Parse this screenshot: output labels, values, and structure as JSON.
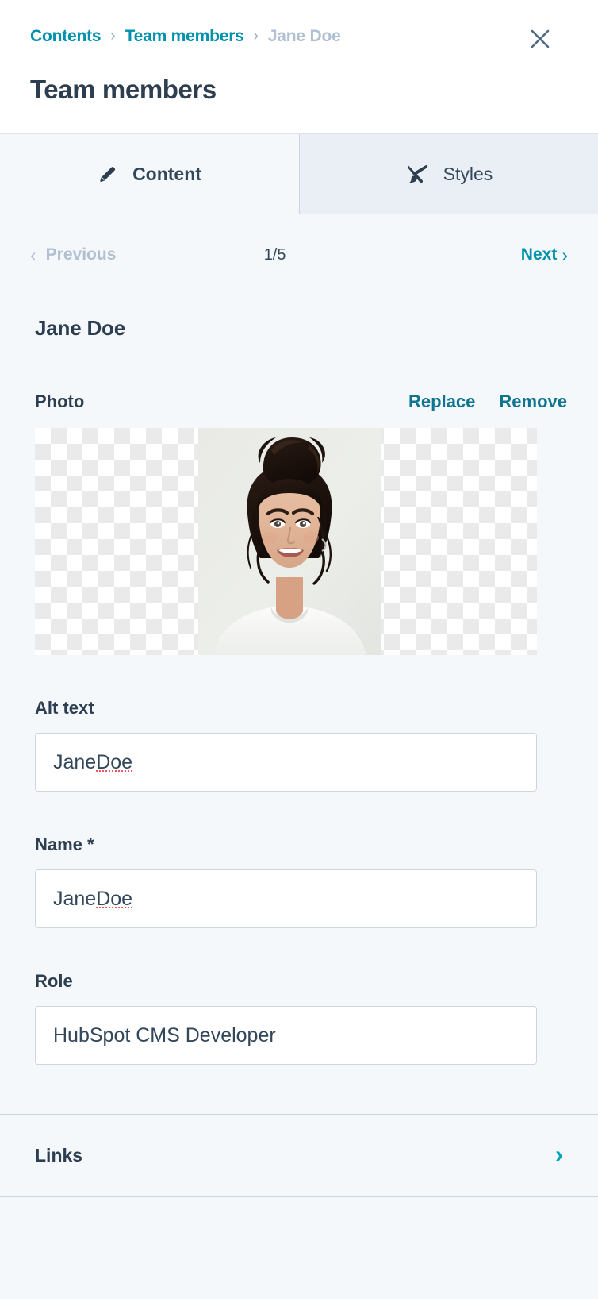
{
  "header": {
    "breadcrumb": [
      {
        "label": "Contents",
        "state": "link"
      },
      {
        "label": "Team members",
        "state": "link"
      },
      {
        "label": "Jane Doe",
        "state": "current"
      }
    ],
    "separator": "›",
    "close_icon": "close-icon",
    "title": "Team members"
  },
  "tabs": [
    {
      "label": "Content",
      "icon": "pencil-icon",
      "active": true
    },
    {
      "label": "Styles",
      "icon": "paintbrush-icon",
      "active": false
    }
  ],
  "pager": {
    "previous_label": "Previous",
    "previous_disabled": true,
    "count": "1/5",
    "next_label": "Next",
    "prev_icon": "chevron-left-icon",
    "next_icon": "chevron-right-icon"
  },
  "member": {
    "name_heading": "Jane Doe"
  },
  "photo": {
    "label": "Photo",
    "replace_label": "Replace",
    "remove_label": "Remove"
  },
  "fields": [
    {
      "label": "Alt text",
      "value": "Jane Doe",
      "value_ok": "Jane ",
      "value_misspelled": "Doe",
      "placeholder": ""
    },
    {
      "label": "Name *",
      "value": "Jane Doe",
      "value_ok": "Jane ",
      "value_misspelled": "Doe",
      "placeholder": ""
    },
    {
      "label": "Role",
      "value": "HubSpot CMS Developer",
      "value_ok": "HubSpot CMS Developer",
      "value_misspelled": "",
      "placeholder": ""
    }
  ],
  "links_section": {
    "label": "Links",
    "chevron": "›",
    "chevron_icon": "chevron-right-icon"
  },
  "colors": {
    "accent_teal": "#0091ae",
    "accent_cyan": "#00a4bd",
    "text_dark": "#2d3e50",
    "text_body": "#33475b",
    "muted": "#b0bfd1",
    "border": "#cbd6e2",
    "bg": "#f5f8fa",
    "spell_error": "#f2545b"
  }
}
